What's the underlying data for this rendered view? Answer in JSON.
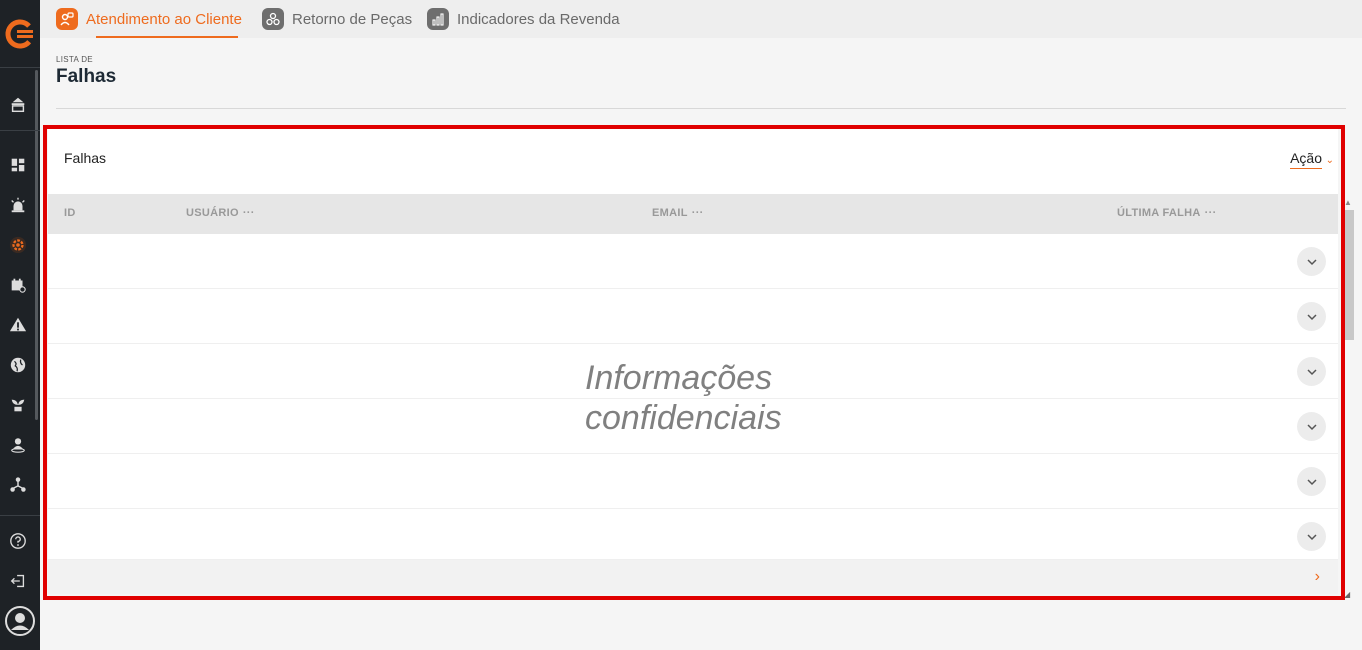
{
  "tabs": [
    {
      "label": "Atendimento ao Cliente",
      "icon": "customer-service-icon",
      "active": true
    },
    {
      "label": "Retorno de Peças",
      "icon": "parts-return-icon",
      "active": false
    },
    {
      "label": "Indicadores da Revenda",
      "icon": "bar-chart-icon",
      "active": false
    }
  ],
  "header": {
    "pre_title": "LISTA DE",
    "title": "Falhas"
  },
  "card": {
    "title": "Falhas",
    "action_label": "Ação",
    "columns": [
      {
        "label": "ID"
      },
      {
        "label": "USUÁRIO",
        "menu": "···"
      },
      {
        "label": "EMAIL",
        "menu": "···"
      },
      {
        "label": "ÚLTIMA FALHA",
        "menu": "···"
      }
    ],
    "overlay_text_line1": "Informações",
    "overlay_text_line2": "confidenciais",
    "footer_next": "›",
    "row_count": 6
  },
  "sidebar": {
    "items": [
      "dealer-icon",
      "dashboard-icon",
      "alarm-icon",
      "settings-gear-icon",
      "calendar-icon",
      "warning-icon",
      "globe-icon",
      "plant-icon",
      "location-user-icon",
      "network-icon"
    ],
    "bottom": [
      "help-icon",
      "logout-icon",
      "profile-avatar-icon"
    ]
  },
  "colors": {
    "accent": "#ee6b1e",
    "sidebar": "#1e2226",
    "highlight": "#e00000"
  }
}
